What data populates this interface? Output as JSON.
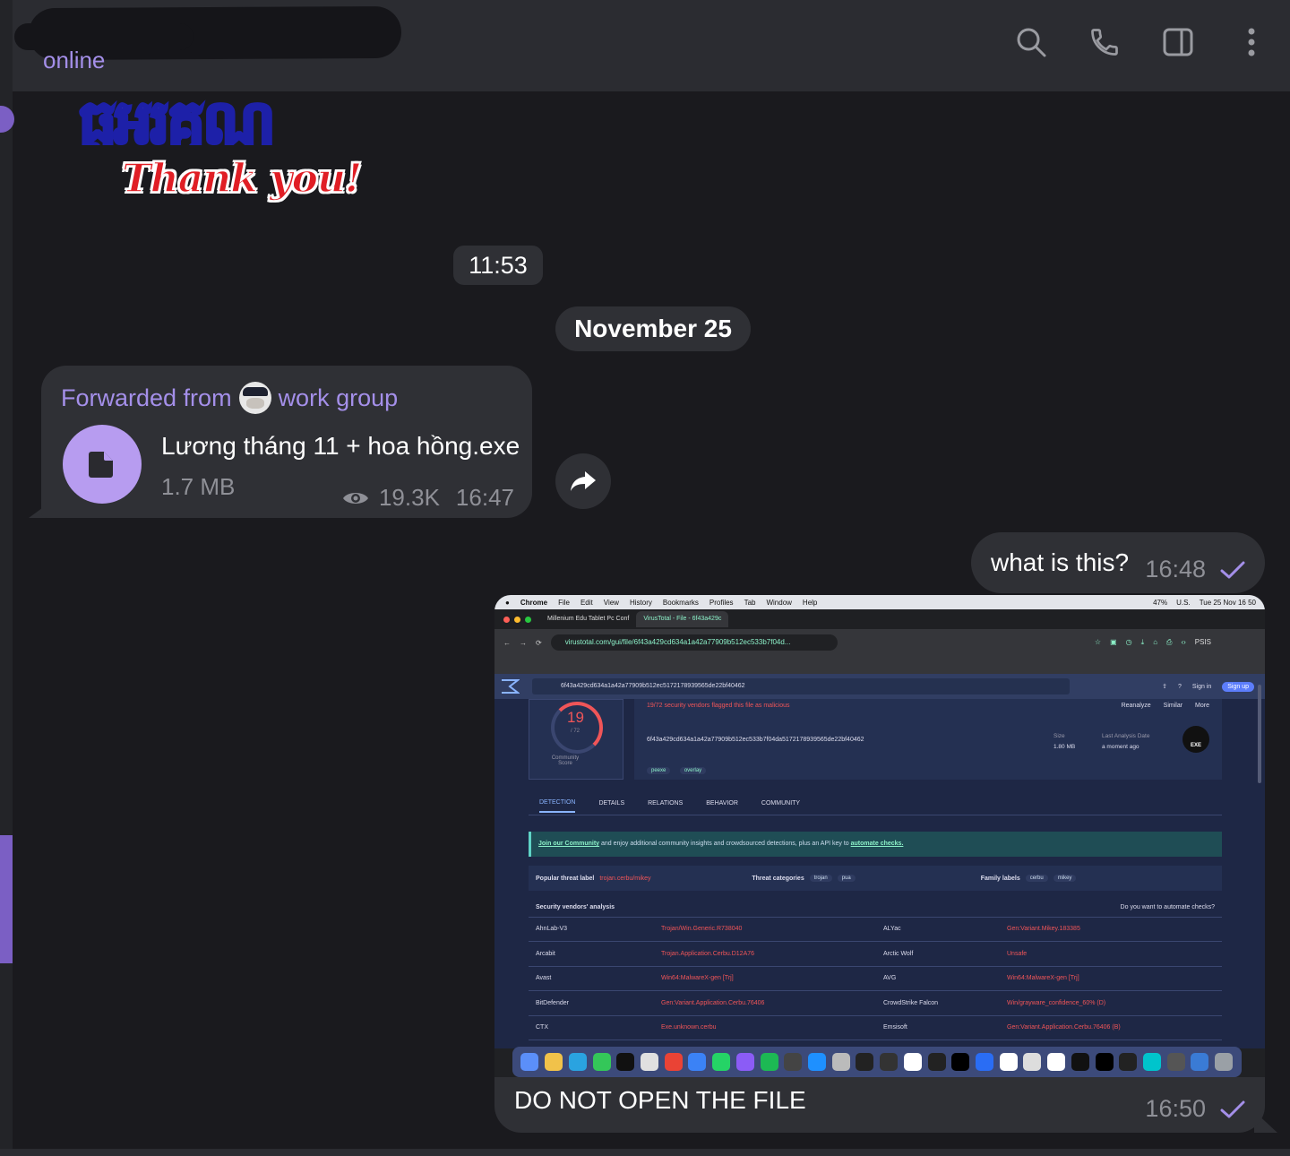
{
  "header": {
    "status": "online",
    "icons": [
      "search-icon",
      "phone-icon",
      "side-panel-icon",
      "more-vert-icon"
    ]
  },
  "sticker": {
    "top_text": "ធ្ងអរគុណ",
    "bottom_text": "Thank you!"
  },
  "separators": {
    "time": "11:53",
    "date": "November 25"
  },
  "forwarded": {
    "prefix": "Forwarded from",
    "source": "work group",
    "file_name": "Lương tháng 11 + hoa hồng.exe",
    "file_size": "1.7 MB",
    "views": "19.3K",
    "time": "16:47"
  },
  "outgoing": {
    "text": "what is this?",
    "time": "16:48"
  },
  "image_message": {
    "caption": "DO NOT OPEN THE FILE",
    "time": "16:50"
  },
  "screenshot": {
    "menu_bar": {
      "app": "Chrome",
      "items": [
        "File",
        "Edit",
        "View",
        "History",
        "Bookmarks",
        "Profiles",
        "Tab",
        "Window",
        "Help"
      ],
      "right": [
        "47%",
        "U.S.",
        "Tue 25 Nov  16 50"
      ]
    },
    "tabs": [
      "Millenium Edu Tablet Pc Conf",
      "VirusTotal - File - 6f43a429c"
    ],
    "url": "virustotal.com/gui/file/6f43a429cd634a1a42a77909b512ec533b7f04d...",
    "profile": "PSIS",
    "search_value": "6f43a429cd634a1a42a77909b512ec5172178939565de22bf40462",
    "sign_in": "Sign in",
    "sign_up": "Sign up",
    "score": "19",
    "score_of": "/ 72",
    "community_label": "Community Score",
    "flagged": "19/72 security vendors flagged this file as malicious",
    "actions": [
      "Reanalyze",
      "Similar",
      "More"
    ],
    "hash": "6f43a429cd634a1a42a77909b512ec533b7f04da5172178939565de22bf40462",
    "size_label": "Size",
    "size_value": "1.80 MB",
    "date_label": "Last Analysis Date",
    "date_value": "a moment ago",
    "file_tags": [
      "peexe",
      "overlay"
    ],
    "file_type": "EXE",
    "nav_tabs": [
      "DETECTION",
      "DETAILS",
      "RELATIONS",
      "BEHAVIOR",
      "COMMUNITY"
    ],
    "community_banner": {
      "link": "Join our Community",
      "text": "and enjoy additional community insights and crowdsourced detections, plus an API key to",
      "link2": "automate checks."
    },
    "threat": {
      "popular_label": "Popular threat label",
      "popular_value": "trojan.cerbu/mikey",
      "categories_label": "Threat categories",
      "categories": [
        "trojan",
        "pua"
      ],
      "family_label": "Family labels",
      "family": [
        "cerbu",
        "mikey"
      ]
    },
    "vendors_title": "Security vendors' analysis",
    "automate": "Do you want to automate checks?",
    "vendors": [
      {
        "a": "AhnLab-V3",
        "ar": "Trojan/Win.Generic.R738040",
        "b": "ALYac",
        "br": "Gen:Variant.Mikey.183385"
      },
      {
        "a": "Arcabit",
        "ar": "Trojan.Application.Cerbu.D12A76",
        "b": "Arctic Wolf",
        "br": "Unsafe"
      },
      {
        "a": "Avast",
        "ar": "Win64:MalwareX-gen [Trj]",
        "b": "AVG",
        "br": "Win64:MalwareX-gen [Trj]"
      },
      {
        "a": "BitDefender",
        "ar": "Gen:Variant.Application.Cerbu.76406",
        "b": "CrowdStrike Falcon",
        "br": "Win/grayware_confidence_60% (D)"
      },
      {
        "a": "CTX",
        "ar": "Exe.unknown.cerbu",
        "b": "Emsisoft",
        "br": "Gen:Variant.Application.Cerbu.76406 (B)"
      }
    ],
    "dock_colors": [
      "#5b8ff9",
      "#f1c24a",
      "#2aa3e0",
      "#34c759",
      "#111111",
      "#e0e0e0",
      "#ea4335",
      "#3b82f6",
      "#25d366",
      "#8b5cf6",
      "#1db954",
      "#444444",
      "#1e90ff",
      "#bbbbbb",
      "#222222",
      "#333333",
      "#ffffff",
      "#222222",
      "#000000",
      "#2a6df4",
      "#ffffff",
      "#dddddd",
      "#ffffff",
      "#111111",
      "#000000",
      "#222222",
      "#00c4cc",
      "#555555",
      "#3a7bd5",
      "#9aa0a6"
    ]
  }
}
